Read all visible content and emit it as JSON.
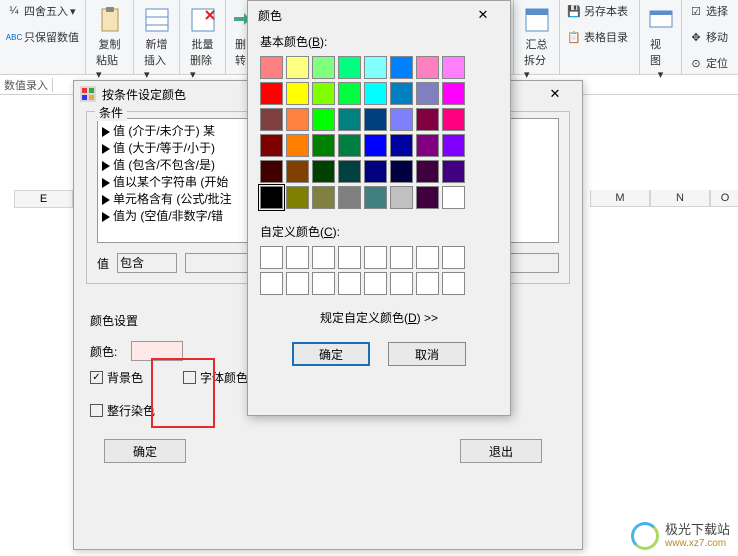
{
  "ribbon": {
    "group1": {
      "round": "四舍五入",
      "keep": "只保留数值"
    },
    "group2": {
      "copy": "复制",
      "paste": "粘贴"
    },
    "group3": {
      "add": "新增",
      "insert": "插入"
    },
    "group4": {
      "batch": "批量",
      "delete": "删除"
    },
    "group5": {
      "turn": "删",
      "ch": "转"
    },
    "group6": {
      "sum": "汇总",
      "split": "拆分"
    },
    "group7": {
      "saveAs": "另存本表",
      "tableList": "表格目录"
    },
    "group8": {
      "view": "视图"
    },
    "group9": {
      "select": "选择",
      "move": "移动",
      "locate": "定位"
    }
  },
  "formulaBar": {
    "label": "数值录入"
  },
  "columns": [
    "E",
    "M",
    "N",
    "O"
  ],
  "dialog1": {
    "title": "按条件设定颜色",
    "conditionGroup": "条件",
    "conditions": [
      "值 (介于/未介于) 某",
      "值 (大于/等于/小于)",
      "值 (包含/不包含/是)",
      "值以某个字符串 (开始",
      "单元格含有 (公式/批注",
      "值为 (空值/非数字/错"
    ],
    "valueLabel": "值",
    "valueSelect": "包含",
    "colorSettings": "颜色设置",
    "colorLabel": "颜色:",
    "bgColor": "背景色",
    "fontColor": "字体颜色",
    "wholeRow": "整行染色",
    "ok": "确定",
    "exit": "退出"
  },
  "dialog2": {
    "title": "颜色",
    "basicLabel": "基本颜色(",
    "basicKey": "B",
    "basicLabelEnd": "):",
    "basicColors": [
      "#ff8080",
      "#ffff80",
      "#80ff80",
      "#00ff80",
      "#80ffff",
      "#0080ff",
      "#ff80c0",
      "#ff80ff",
      "#ff0000",
      "#ffff00",
      "#80ff00",
      "#00ff40",
      "#00ffff",
      "#0080c0",
      "#8080c0",
      "#ff00ff",
      "#804040",
      "#ff8040",
      "#00ff00",
      "#008080",
      "#004080",
      "#8080ff",
      "#800040",
      "#ff0080",
      "#800000",
      "#ff8000",
      "#008000",
      "#008040",
      "#0000ff",
      "#0000a0",
      "#800080",
      "#8000ff",
      "#400000",
      "#804000",
      "#004000",
      "#004040",
      "#000080",
      "#000040",
      "#400040",
      "#400080",
      "#000000",
      "#808000",
      "#808040",
      "#808080",
      "#408080",
      "#c0c0c0",
      "#400040",
      "#ffffff"
    ],
    "customLabel": "自定义颜色(",
    "customKey": "C",
    "customLabelEnd": "):",
    "defineLabel": "规定自定义颜色(",
    "defineKey": "D",
    "defineEnd": ") >>",
    "ok": "确定",
    "cancel": "取消"
  },
  "watermark": {
    "cn": "极光下载站",
    "url": "www.xz7.com"
  }
}
